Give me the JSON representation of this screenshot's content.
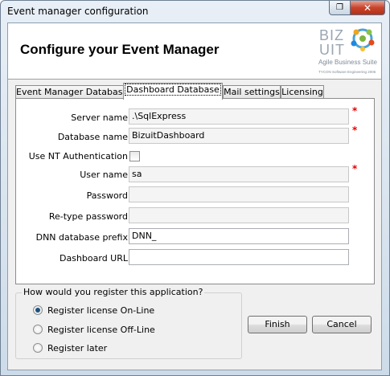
{
  "window": {
    "title": "Event manager configuration"
  },
  "header": {
    "title": "Configure your Event Manager",
    "logo_text": "BIZ UIT",
    "logo_subtitle": "Agile Business Suite",
    "logo_caption": "TYCON Software Engineering 2006"
  },
  "tabs": [
    {
      "label": "Event Manager Database",
      "active": false
    },
    {
      "label": "Dashboard Database",
      "active": true
    },
    {
      "label": "Mail settings",
      "active": false
    },
    {
      "label": "Licensing",
      "active": false
    }
  ],
  "form": {
    "server_name": {
      "label": "Server name",
      "value": ".\\SqlExpress",
      "required": "*"
    },
    "database_name": {
      "label": "Database name",
      "value": "BizuitDashboard",
      "required": "*"
    },
    "use_nt_auth": {
      "label": "Use NT Authentication",
      "checked": false
    },
    "user_name": {
      "label": "User name",
      "value": "sa",
      "required": "*"
    },
    "password": {
      "label": "Password",
      "value": ""
    },
    "retype_password": {
      "label": "Re-type password",
      "value": ""
    },
    "dnn_prefix": {
      "label": "DNN database prefix",
      "value": "DNN_"
    },
    "dashboard_url": {
      "label": "Dashboard URL",
      "value": ""
    }
  },
  "registration": {
    "legend": "How would you register this application?",
    "options": [
      {
        "label": "Register license On-Line",
        "selected": true
      },
      {
        "label": "Register license Off-Line",
        "selected": false
      },
      {
        "label": "Register later",
        "selected": false
      }
    ]
  },
  "buttons": {
    "finish": "Finish",
    "cancel": "Cancel"
  },
  "colors": {
    "required": "#e00000",
    "close_button": "#c7442c"
  }
}
